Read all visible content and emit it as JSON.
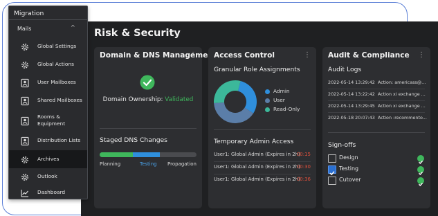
{
  "main": {
    "title": "Risk & Security"
  },
  "sidebar": {
    "title": "Migration",
    "section": "Mails",
    "items": [
      {
        "label": "Global Settings",
        "icon": "gear-icon"
      },
      {
        "label": "Global Actions",
        "icon": "gear-icon"
      },
      {
        "label": "User Mailboxes",
        "icon": "user-mailbox-icon"
      },
      {
        "label": "Shared Mailboxes",
        "icon": "shared-mailbox-icon"
      },
      {
        "label": "Rooms &\nEquipment",
        "icon": "rooms-icon"
      },
      {
        "label": "Distribution Lists",
        "icon": "distribution-list-icon"
      },
      {
        "label": "Archives",
        "icon": "gear-icon",
        "active": true
      },
      {
        "label": "Outlook",
        "icon": "gear-icon"
      },
      {
        "label": "Dashboard",
        "icon": "dashboard-icon"
      }
    ]
  },
  "dns": {
    "title": "Domain & DNS Management",
    "ownership_label": "Domain Ownership:",
    "ownership_value": "Validated",
    "staged_title": "Staged DNS Changes",
    "stages": [
      "Planning",
      "Testing",
      "Propagation"
    ],
    "progress": 0.62,
    "colors": {
      "green": "#3fb75c",
      "blue": "#2f8fdc"
    }
  },
  "access": {
    "title": "Access Control",
    "roles_title": "Granular Role Assignments",
    "legend": [
      {
        "label": "Admin",
        "color": "#2f8fdc",
        "value": 30
      },
      {
        "label": "User",
        "color": "#5b7ea8",
        "value": 40
      },
      {
        "label": "Read-Only",
        "color": "#3cb89a",
        "value": 30
      }
    ],
    "temp_title": "Temporary Admin Access",
    "temp_rows": [
      {
        "label": "User1: Global Admin (Expires in 2h)",
        "time": "00:15"
      },
      {
        "label": "User1: Global Admin (Expires in 2h)",
        "time": "00:30"
      },
      {
        "label": "User1: Global Admin (Expires in 2h)",
        "time": "00:36"
      }
    ],
    "time_color": "#e0503c"
  },
  "audit": {
    "title": "Audit & Compliance",
    "logs_title": "Audit Logs",
    "logs": [
      {
        "date": "2022-05-14 13:29:42",
        "action": "Action: americass@..."
      },
      {
        "date": "2022-05-14 13:22:42",
        "action": "Action xi exchange ..."
      },
      {
        "date": "2022-05-14 13:29:45",
        "action": "Action xi exchange ..."
      },
      {
        "date": "2022-05-18 20:07:43",
        "action": "Action :recommento..."
      }
    ],
    "signoffs_title": "Sign-offs",
    "signoffs": [
      {
        "label": "Design",
        "checked": false
      },
      {
        "label": "Testing",
        "checked": true
      },
      {
        "label": "Cutover",
        "checked": false
      }
    ]
  }
}
